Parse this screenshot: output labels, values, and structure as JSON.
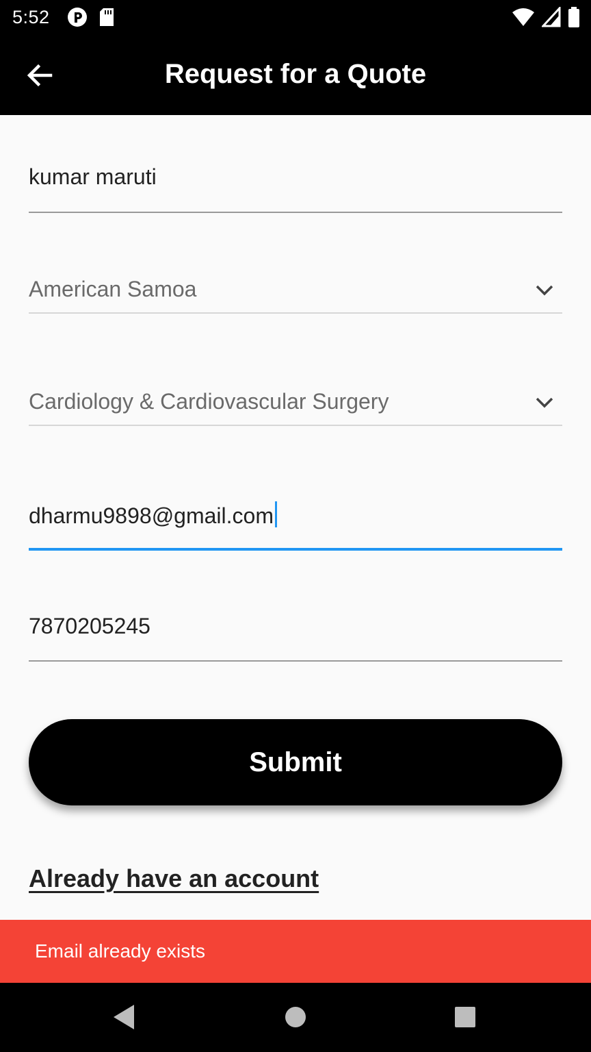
{
  "status_bar": {
    "time": "5:52"
  },
  "app_bar": {
    "title": "Request for a Quote"
  },
  "form": {
    "name_value": "kumar maruti",
    "country_value": "American Samoa",
    "specialty_value": "Cardiology & Cardiovascular Surgery",
    "email_value": "dharmu9898@gmail.com",
    "phone_value": "7870205245"
  },
  "actions": {
    "submit_label": "Submit",
    "login_link": "Already have an account"
  },
  "snackbar": {
    "message": "Email already exists",
    "color": "#f44336"
  },
  "colors": {
    "focus": "#2196f3",
    "app_bar": "#000000"
  }
}
